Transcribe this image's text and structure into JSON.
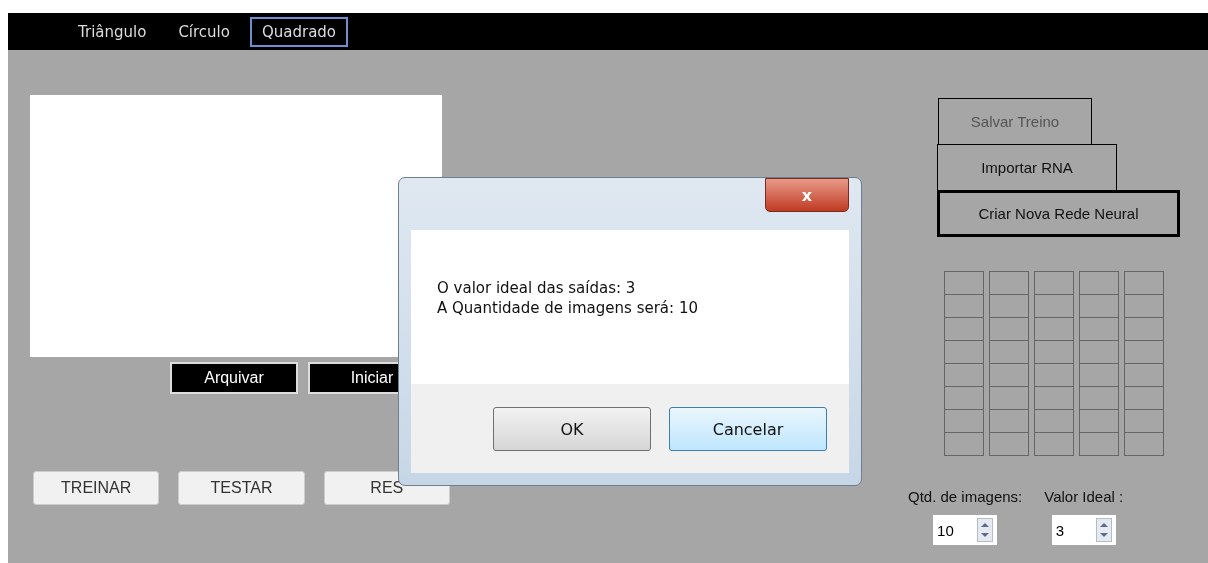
{
  "tabs": [
    {
      "label": "Triângulo",
      "selected": false
    },
    {
      "label": "Círculo",
      "selected": false
    },
    {
      "label": "Quadrado",
      "selected": true
    }
  ],
  "image_buttons": [
    "Arquivar",
    "Iniciar"
  ],
  "action_buttons": [
    "TREINAR",
    "TESTAR",
    "RES"
  ],
  "side_buttons": [
    {
      "label": "Salvar Treino",
      "disabled": true,
      "focused": false
    },
    {
      "label": "Importar RNA",
      "disabled": false,
      "focused": false
    },
    {
      "label": "Criar Nova Rede Neural",
      "disabled": false,
      "focused": true
    }
  ],
  "spinners": [
    {
      "label": "Qtd. de imagens:",
      "value": "10"
    },
    {
      "label": "Valor Ideal :",
      "value": "3"
    }
  ],
  "dialog": {
    "close": "x",
    "lines": [
      "O valor ideal das saídas: 3",
      "A Quantidade de imagens será: 10"
    ],
    "buttons": [
      {
        "label": "OK",
        "selected": false
      },
      {
        "label": "Cancelar",
        "selected": true
      }
    ]
  }
}
